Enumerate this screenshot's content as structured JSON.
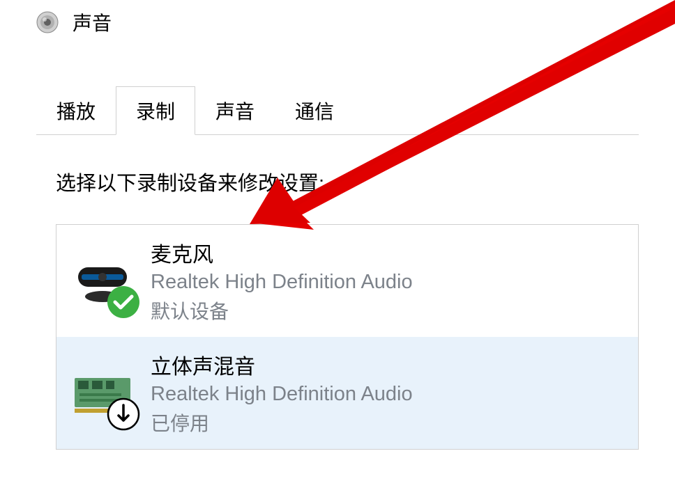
{
  "window": {
    "title": "声音"
  },
  "tabs": [
    {
      "label": "播放",
      "active": false
    },
    {
      "label": "录制",
      "active": true
    },
    {
      "label": "声音",
      "active": false
    },
    {
      "label": "通信",
      "active": false
    }
  ],
  "content": {
    "instruction": "选择以下录制设备来修改设置:"
  },
  "devices": [
    {
      "name": "麦克风",
      "driver": "Realtek High Definition Audio",
      "status": "默认设备",
      "statusType": "default",
      "selected": false
    },
    {
      "name": "立体声混音",
      "driver": "Realtek High Definition Audio",
      "status": "已停用",
      "statusType": "disabled",
      "selected": true
    }
  ]
}
